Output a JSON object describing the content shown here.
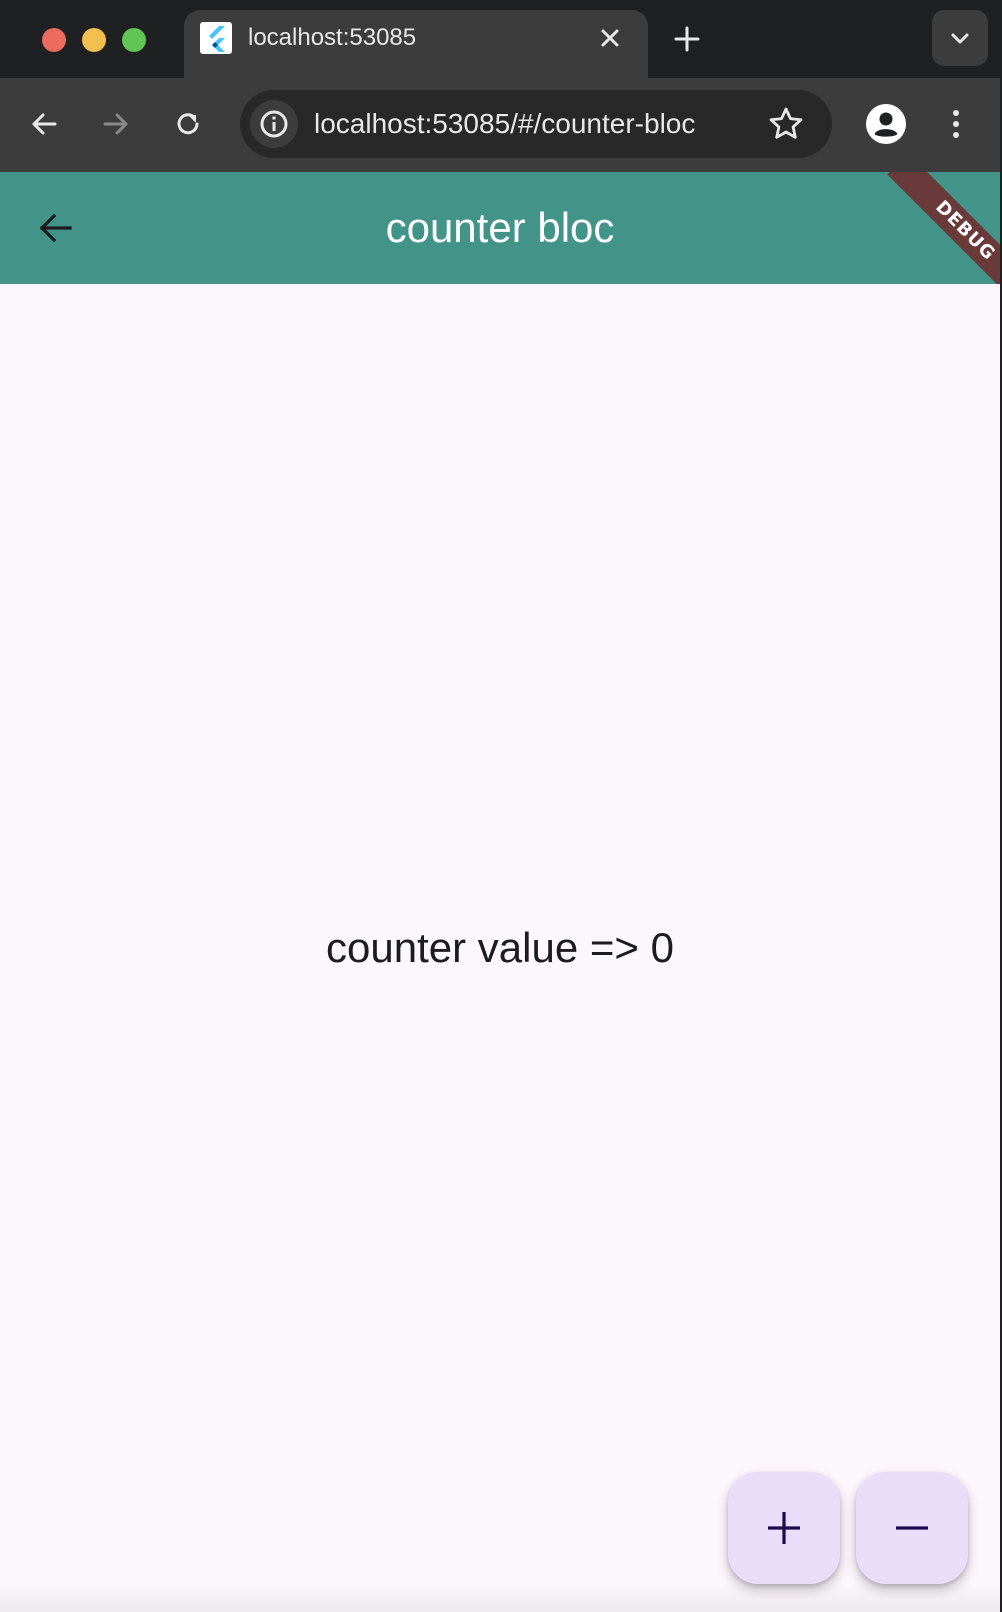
{
  "browser": {
    "tab": {
      "title": "localhost:53085"
    },
    "address_bar": {
      "url": "localhost:53085/#/counter-bloc"
    }
  },
  "app": {
    "appbar": {
      "title": "counter bloc",
      "debug_banner": "DEBUG",
      "color": "#429488"
    },
    "counter": {
      "label": "counter value => 0"
    },
    "fab_color": "#e8def9",
    "icon_color": "#1d0a4e"
  }
}
